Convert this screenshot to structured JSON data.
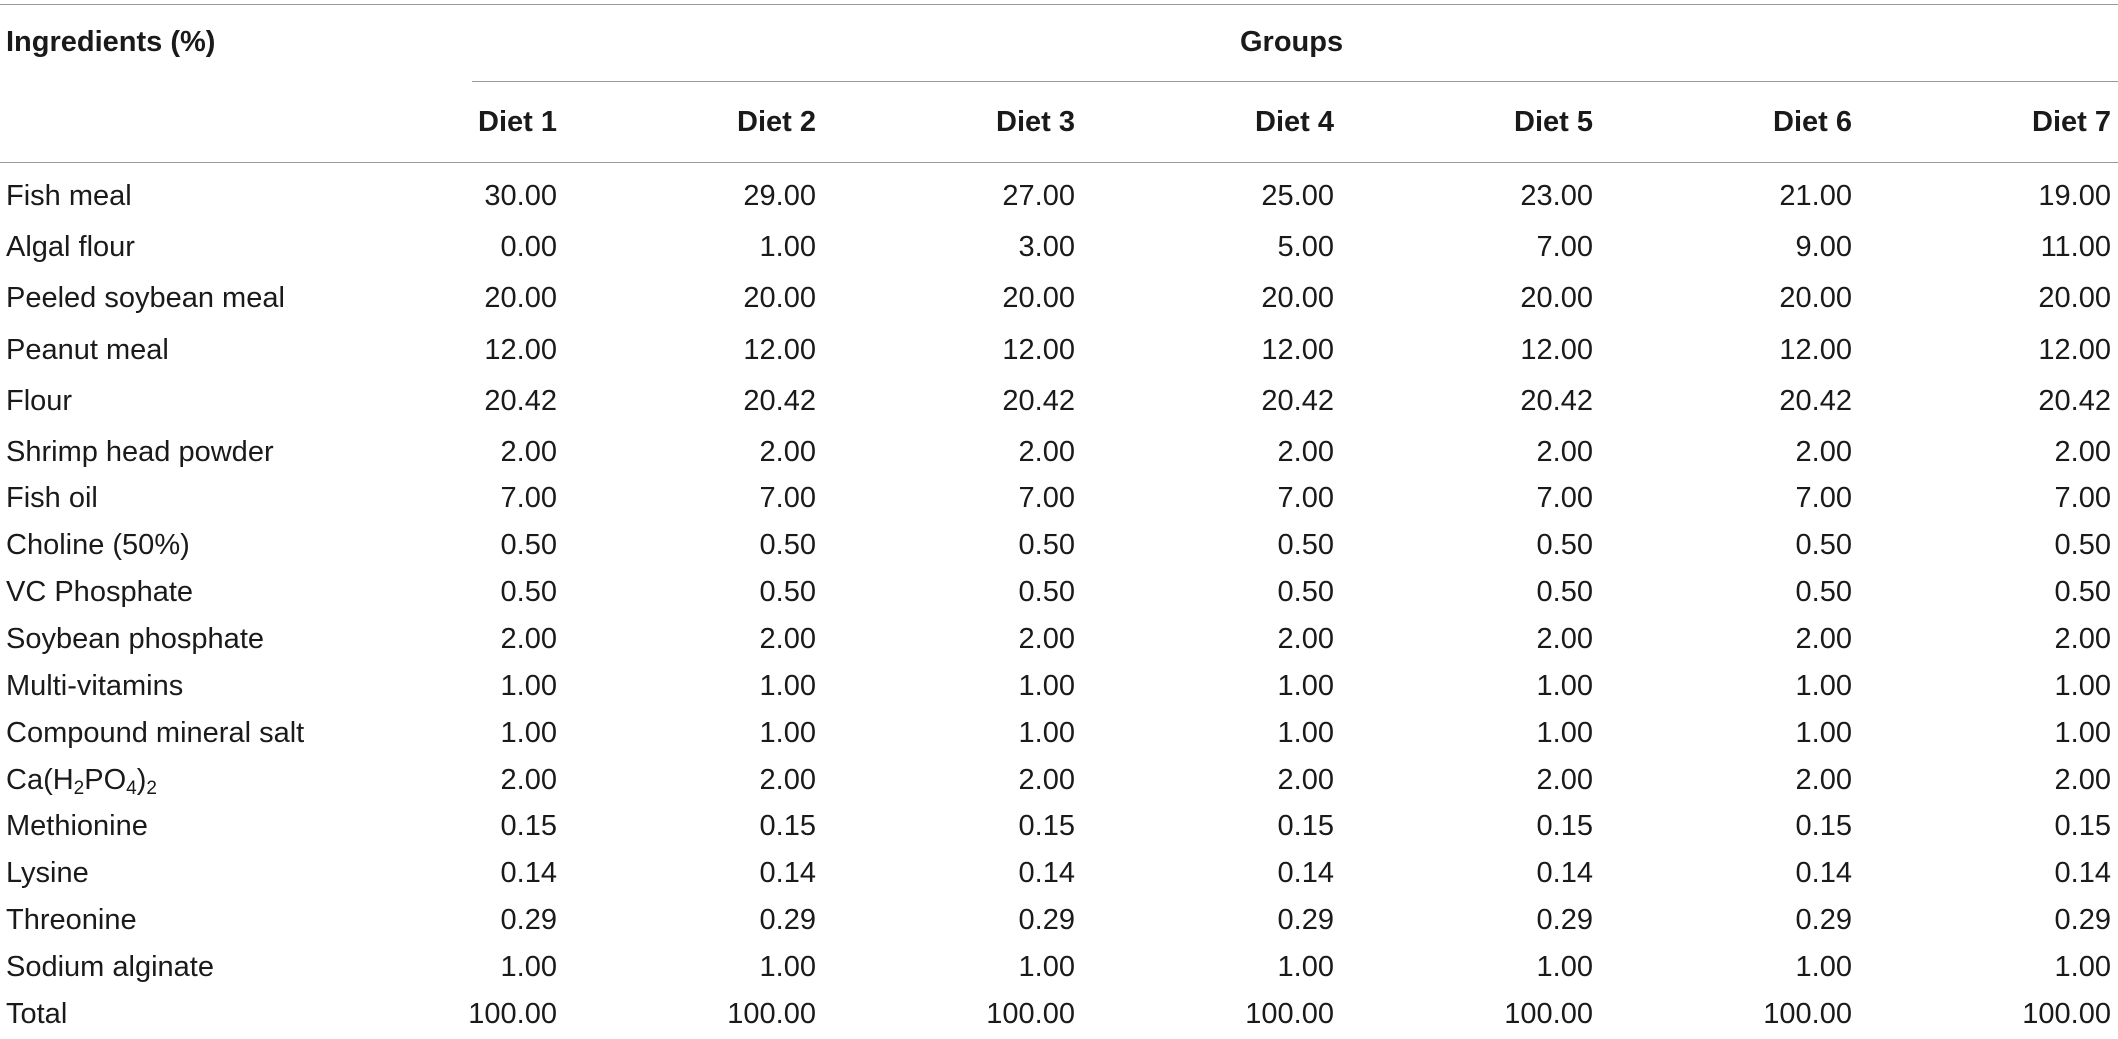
{
  "table": {
    "stub_header": "Ingredients (%)",
    "group_header": "Groups",
    "columns": [
      "Diet 1",
      "Diet 2",
      "Diet 3",
      "Diet 4",
      "Diet 5",
      "Diet 6",
      "Diet 7"
    ],
    "rows": [
      {
        "label": "Fish meal",
        "values": [
          "30.00",
          "29.00",
          "27.00",
          "25.00",
          "23.00",
          "21.00",
          "19.00"
        ]
      },
      {
        "label": "Algal flour",
        "values": [
          "0.00",
          "1.00",
          "3.00",
          "5.00",
          "7.00",
          "9.00",
          "11.00"
        ]
      },
      {
        "label": "Peeled soybean meal",
        "values": [
          "20.00",
          "20.00",
          "20.00",
          "20.00",
          "20.00",
          "20.00",
          "20.00"
        ]
      },
      {
        "label": "Peanut meal",
        "values": [
          "12.00",
          "12.00",
          "12.00",
          "12.00",
          "12.00",
          "12.00",
          "12.00"
        ]
      },
      {
        "label": "Flour",
        "values": [
          "20.42",
          "20.42",
          "20.42",
          "20.42",
          "20.42",
          "20.42",
          "20.42"
        ]
      },
      {
        "label": "Shrimp head powder",
        "values": [
          "2.00",
          "2.00",
          "2.00",
          "2.00",
          "2.00",
          "2.00",
          "2.00"
        ]
      },
      {
        "label": "Fish oil",
        "values": [
          "7.00",
          "7.00",
          "7.00",
          "7.00",
          "7.00",
          "7.00",
          "7.00"
        ]
      },
      {
        "label": "Choline (50%)",
        "values": [
          "0.50",
          "0.50",
          "0.50",
          "0.50",
          "0.50",
          "0.50",
          "0.50"
        ]
      },
      {
        "label": "VC Phosphate",
        "values": [
          "0.50",
          "0.50",
          "0.50",
          "0.50",
          "0.50",
          "0.50",
          "0.50"
        ]
      },
      {
        "label": "Soybean phosphate",
        "values": [
          "2.00",
          "2.00",
          "2.00",
          "2.00",
          "2.00",
          "2.00",
          "2.00"
        ]
      },
      {
        "label": "Multi-vitamins",
        "values": [
          "1.00",
          "1.00",
          "1.00",
          "1.00",
          "1.00",
          "1.00",
          "1.00"
        ]
      },
      {
        "label": "Compound mineral salt",
        "values": [
          "1.00",
          "1.00",
          "1.00",
          "1.00",
          "1.00",
          "1.00",
          "1.00"
        ]
      },
      {
        "label_parts": [
          "Ca(H",
          "2",
          "PO",
          "4",
          ")",
          "2"
        ],
        "values": [
          "2.00",
          "2.00",
          "2.00",
          "2.00",
          "2.00",
          "2.00",
          "2.00"
        ]
      },
      {
        "label": "Methionine",
        "values": [
          "0.15",
          "0.15",
          "0.15",
          "0.15",
          "0.15",
          "0.15",
          "0.15"
        ]
      },
      {
        "label": "Lysine",
        "values": [
          "0.14",
          "0.14",
          "0.14",
          "0.14",
          "0.14",
          "0.14",
          "0.14"
        ]
      },
      {
        "label": "Threonine",
        "values": [
          "0.29",
          "0.29",
          "0.29",
          "0.29",
          "0.29",
          "0.29",
          "0.29"
        ]
      },
      {
        "label": "Sodium alginate",
        "values": [
          "1.00",
          "1.00",
          "1.00",
          "1.00",
          "1.00",
          "1.00",
          "1.00"
        ]
      },
      {
        "label": "Total",
        "values": [
          "100.00",
          "100.00",
          "100.00",
          "100.00",
          "100.00",
          "100.00",
          "100.00"
        ]
      }
    ]
  }
}
